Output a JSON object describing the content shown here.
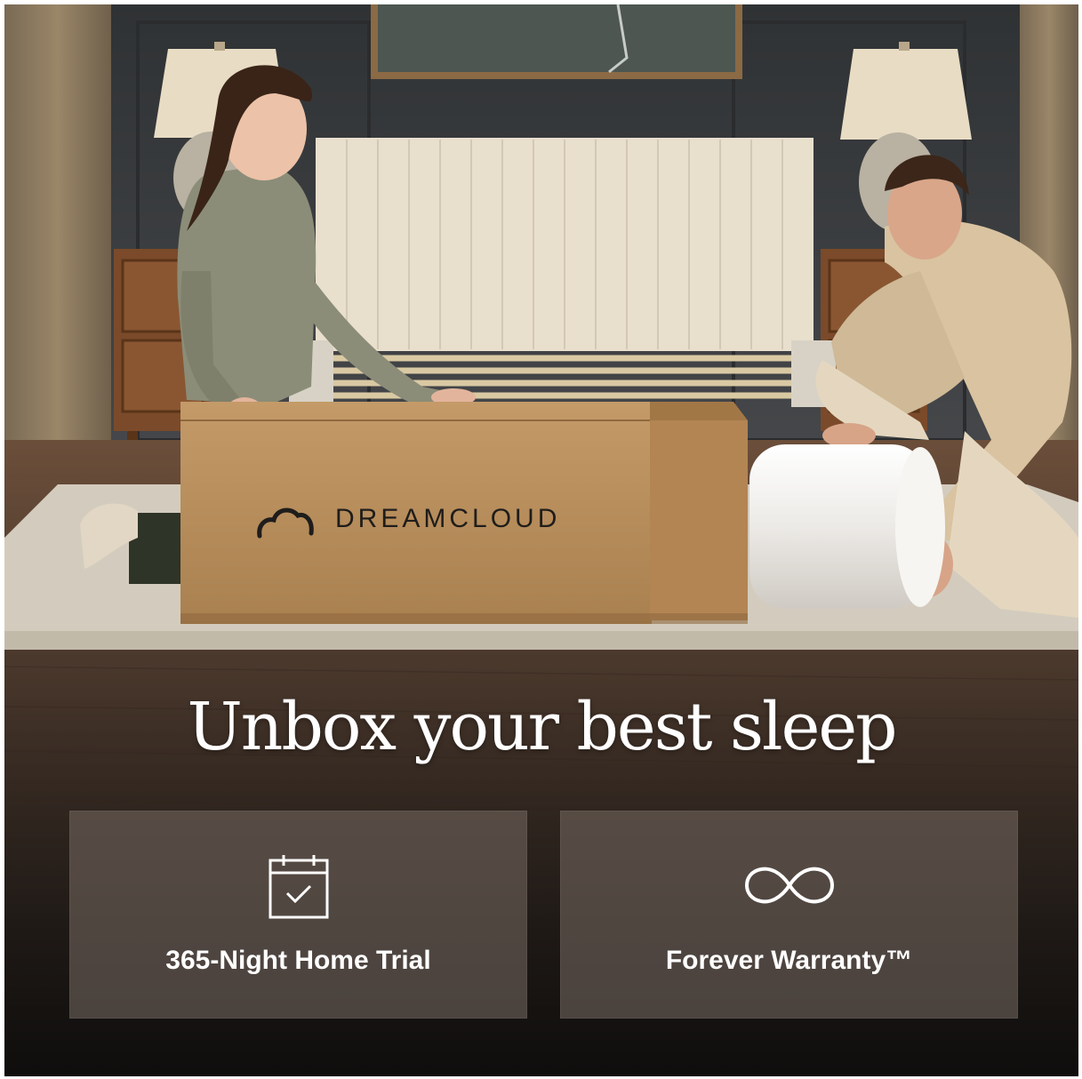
{
  "headline": "Unbox your best sleep",
  "box_brand": "DREAMCLOUD",
  "features": [
    {
      "label": "365-Night Home Trial",
      "icon": "calendar-check-icon"
    },
    {
      "label": "Forever Warranty™",
      "icon": "infinity-icon"
    }
  ],
  "colors": {
    "text": "#ffffff",
    "wall": "#3a3c3f",
    "cardboard": "#b58a58",
    "card_overlay": "rgba(120,108,100,0.55)"
  }
}
